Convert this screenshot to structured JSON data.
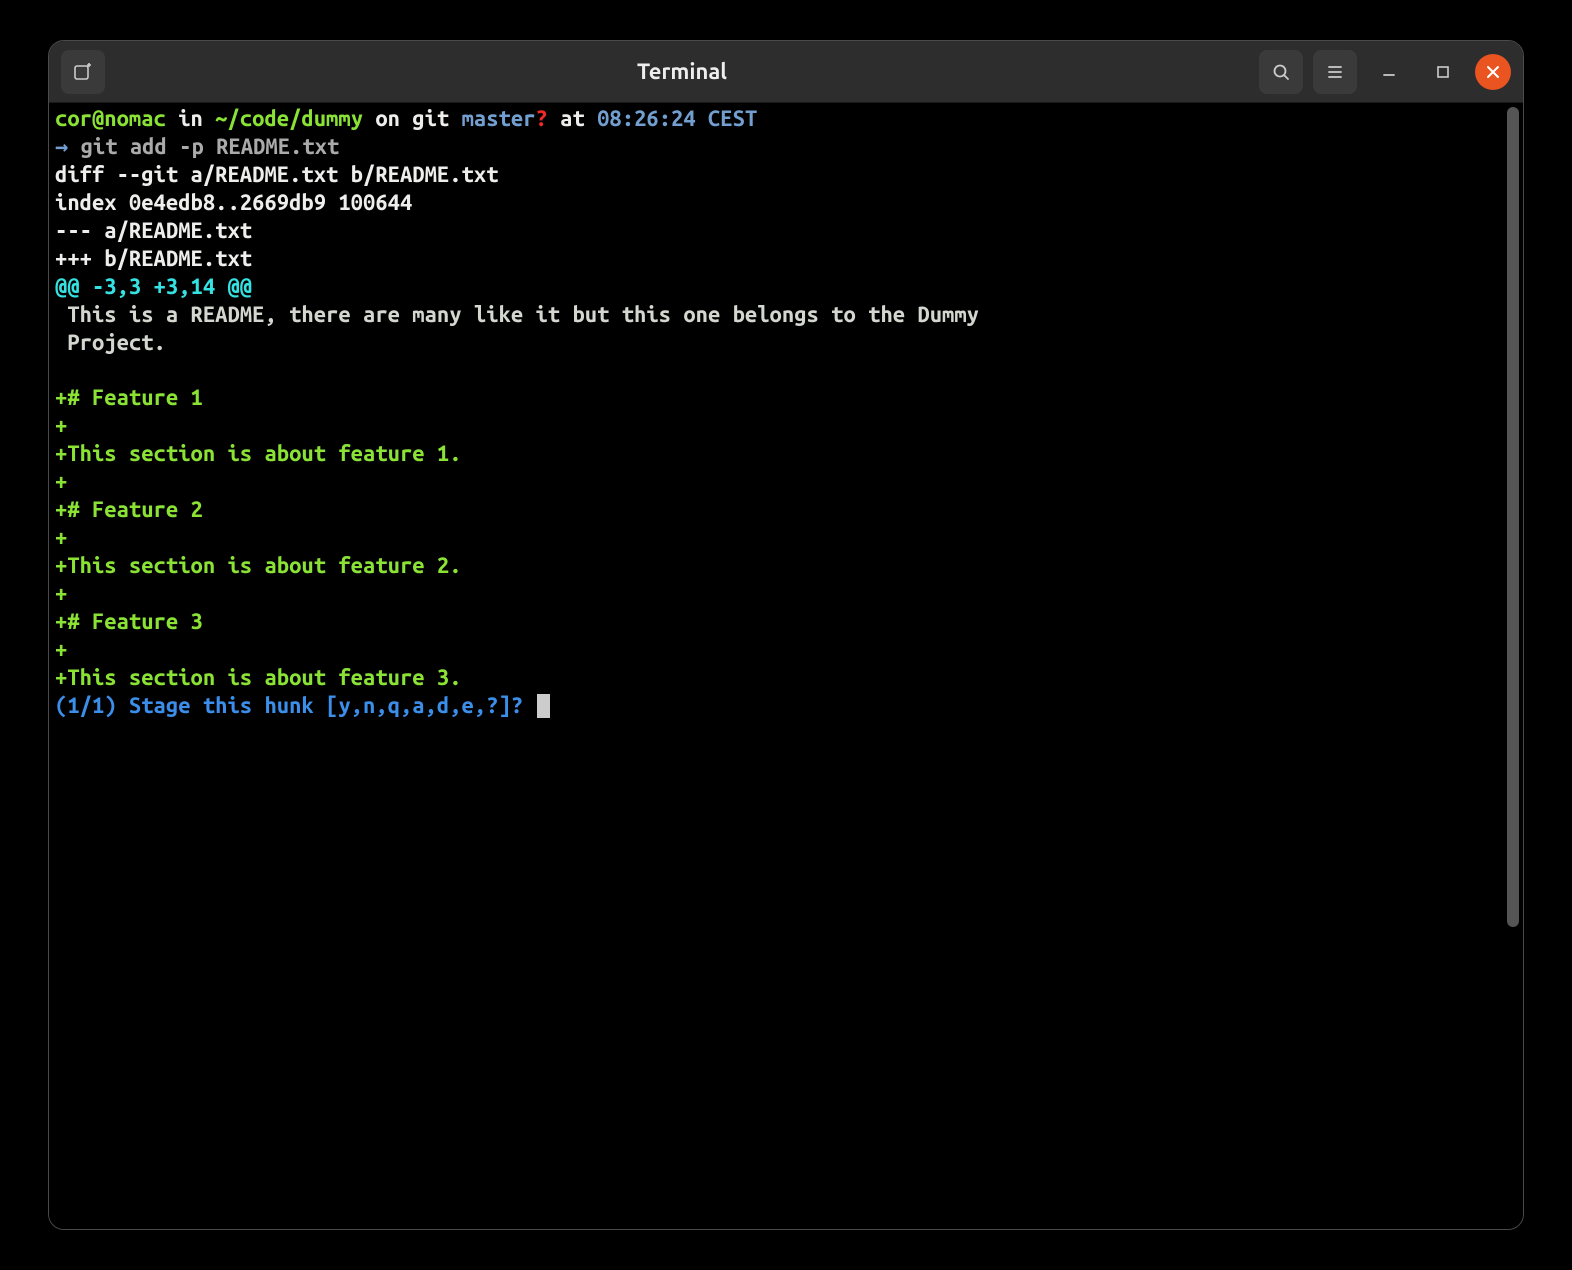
{
  "window": {
    "title": "Terminal"
  },
  "prompt": {
    "user_host": "cor@nomac",
    "in": " in ",
    "path": "~/code/dummy",
    "on": " on git ",
    "branch": "master",
    "dirty": "?",
    "at": " at ",
    "time": "08:26:24 CEST",
    "arrow": "→ ",
    "command": "git add -p README.txt"
  },
  "diff": {
    "header1": "diff --git a/README.txt b/README.txt",
    "header2": "index 0e4edb8..2669db9 100644",
    "header3": "--- a/README.txt",
    "header4": "+++ b/README.txt",
    "hunk": "@@ -3,3 +3,14 @@",
    "context1": " This is a README, there are many like it but this one belongs to the Dummy",
    "context2": " Project.",
    "blank": " ",
    "add01": "+# Feature 1",
    "add02": "+",
    "add03": "+This section is about feature 1.",
    "add04": "+",
    "add05": "+# Feature 2",
    "add06": "+",
    "add07": "+This section is about feature 2.",
    "add08": "+",
    "add09": "+# Feature 3",
    "add10": "+",
    "add11": "+This section is about feature 3."
  },
  "stage_prompt": "(1/1) Stage this hunk [y,n,q,a,d,e,?]? "
}
